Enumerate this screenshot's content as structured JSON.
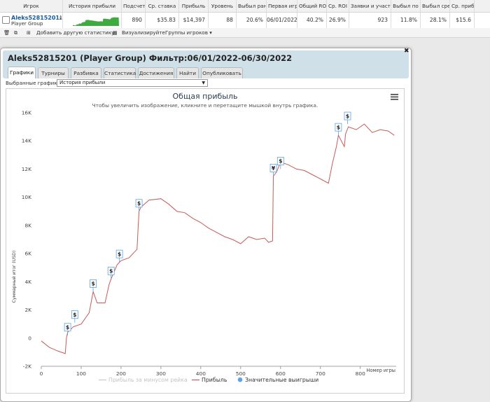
{
  "table": {
    "columns": [
      {
        "label": "Игрок",
        "w": 90
      },
      {
        "label": "История прибыли",
        "w": 84
      },
      {
        "label": "Подсчет",
        "w": 34
      },
      {
        "label": "Ср. ставка",
        "w": 48
      },
      {
        "label": "Прибыль",
        "w": 42
      },
      {
        "label": "Уровень",
        "w": 40
      },
      {
        "label": "Выбыл ран",
        "w": 43
      },
      {
        "label": "Первая игр",
        "w": 44
      },
      {
        "label": "Общий RO",
        "w": 42
      },
      {
        "label": "Ср. ROI",
        "w": 32
      },
      {
        "label": "Заявки и участ",
        "w": 60
      },
      {
        "label": "Выбыл по",
        "w": 42
      },
      {
        "label": "Выбыл сре",
        "w": 42
      },
      {
        "label": "Ср. прибыл",
        "w": 35
      }
    ],
    "player_name": "Aleks52815201",
    "player_group": "Player Group",
    "values": [
      "890",
      "$35.83",
      "$14,397",
      "88",
      "20.6%",
      "06/01/2022",
      "40.2%",
      "26.9%",
      "923",
      "11.8%",
      "28.1%",
      "$15.6"
    ]
  },
  "toolbar": {
    "add_stats": "Добавить другую статистику",
    "visualize": "Визуализируйте",
    "groups": "Группы игроков"
  },
  "dialog": {
    "title": "Aleks52815201 (Player Group) Фильтр:06/01/2022-06/30/2022",
    "tabs": [
      "Графики",
      "Турниры",
      "Разбивка",
      "Статистика",
      "Достижения",
      "Найти",
      "Опубликовать"
    ],
    "selected_charts_label": "Выбранные графики:",
    "selected_chart": "История прибыли"
  },
  "colors": {
    "line": "#c65a5a",
    "legend_off": "#c8c8c8",
    "marker_blue": "#5ca4e4",
    "title": "#2a3f55",
    "sparkline": "#3eab3e"
  },
  "chart_data": {
    "type": "line",
    "title": "Общая прибыль",
    "subtitle": "Чтобы увеличить изображение, кликните и перетащите мышкой внутрь графика.",
    "xlabel": "Номер игры",
    "ylabel": "Суммарный итог (USD)",
    "xlim": [
      0,
      890
    ],
    "ylim": [
      -2000,
      16000
    ],
    "x_ticks": [
      "0",
      "100",
      "200",
      "300",
      "400",
      "500",
      "600",
      "700",
      "800"
    ],
    "y_ticks": [
      "-2K",
      "0",
      "2K",
      "4K",
      "6K",
      "8K",
      "10K",
      "12K",
      "14K",
      "16K"
    ],
    "grid": false,
    "legend_position": "bottom",
    "legend": [
      "Прибыль за минусом рейка",
      "Прибыль",
      "Значительные выигрыши"
    ],
    "series": [
      {
        "name": "Прибыль",
        "x": [
          0,
          20,
          40,
          60,
          63,
          66,
          80,
          100,
          120,
          130,
          140,
          160,
          170,
          175,
          190,
          200,
          220,
          240,
          245,
          250,
          270,
          300,
          320,
          340,
          360,
          380,
          400,
          420,
          440,
          460,
          480,
          500,
          520,
          540,
          560,
          570,
          580,
          582,
          590,
          600,
          620,
          640,
          660,
          680,
          700,
          720,
          730,
          740,
          745,
          760,
          763,
          770,
          790,
          810,
          830,
          850,
          870,
          885
        ],
        "y": [
          -200,
          -650,
          -900,
          -1100,
          0,
          400,
          800,
          1000,
          1800,
          3300,
          2500,
          2500,
          3800,
          4200,
          5200,
          5500,
          5700,
          6300,
          9000,
          9300,
          9800,
          9900,
          9500,
          9000,
          8900,
          8500,
          8200,
          7800,
          7500,
          7200,
          7000,
          6700,
          7200,
          7000,
          7100,
          6800,
          6900,
          11500,
          11800,
          12500,
          12300,
          12000,
          11900,
          11600,
          11300,
          11000,
          12400,
          13600,
          14400,
          13600,
          14500,
          15000,
          14800,
          15200,
          14600,
          14800,
          14700,
          14400
        ]
      }
    ],
    "big_wins": [
      {
        "x": 66,
        "y": 200,
        "label": "$"
      },
      {
        "x": 84,
        "y": 1100,
        "label": "$"
      },
      {
        "x": 130,
        "y": 3300,
        "label": "$"
      },
      {
        "x": 175,
        "y": 4200,
        "label": "$"
      },
      {
        "x": 196,
        "y": 5400,
        "label": "$"
      },
      {
        "x": 245,
        "y": 9000,
        "label": "$"
      },
      {
        "x": 582,
        "y": 11500,
        "label": "¥"
      },
      {
        "x": 600,
        "y": 12000,
        "label": "$"
      },
      {
        "x": 745,
        "y": 14400,
        "label": "$"
      },
      {
        "x": 768,
        "y": 15200,
        "label": "$"
      }
    ]
  }
}
